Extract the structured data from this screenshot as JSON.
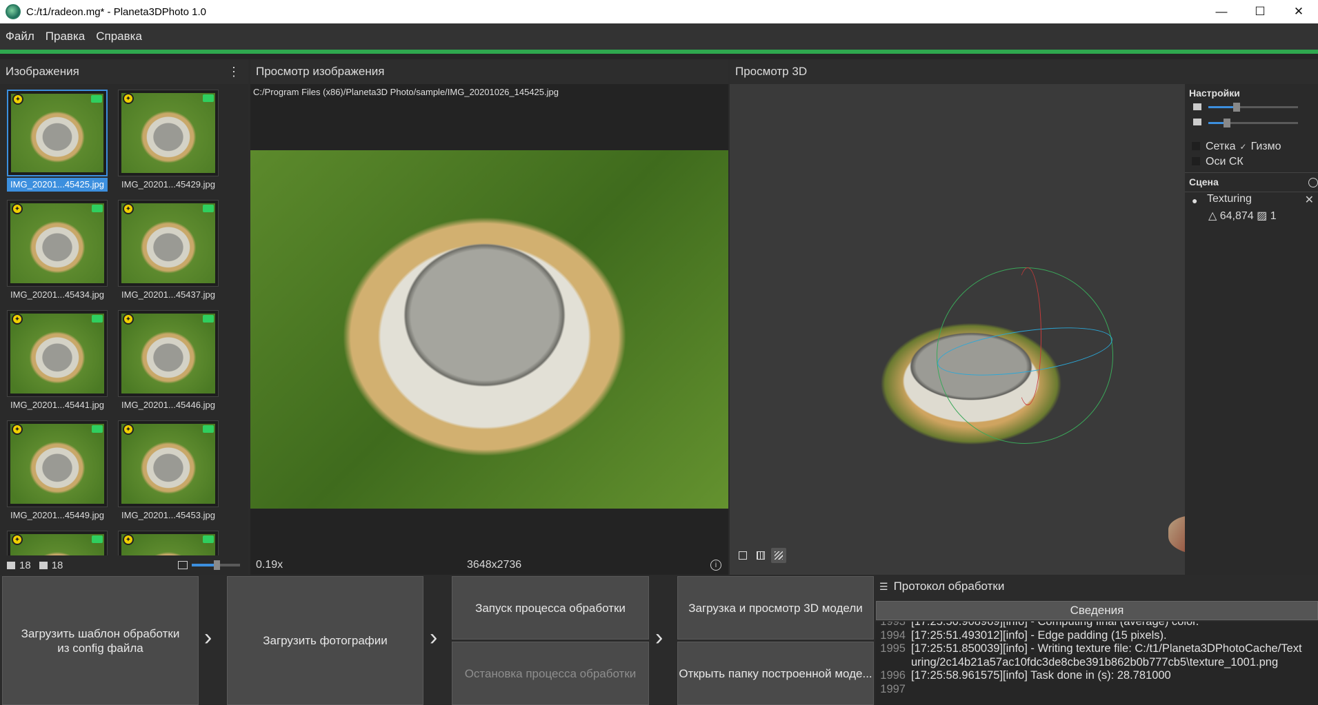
{
  "window": {
    "title": "C:/t1/radeon.mg* - Planeta3DPhoto 1.0",
    "minimize": "—",
    "maximize": "☐",
    "close": "✕"
  },
  "menu": [
    "Файл",
    "Правка",
    "Справка"
  ],
  "images_panel": {
    "title": "Изображения",
    "kebab": "⋮",
    "thumbnails": [
      {
        "name": "IMG_20201...45425.jpg",
        "selected": true
      },
      {
        "name": "IMG_20201...45429.jpg"
      },
      {
        "name": "IMG_20201...45434.jpg"
      },
      {
        "name": "IMG_20201...45437.jpg"
      },
      {
        "name": "IMG_20201...45441.jpg"
      },
      {
        "name": "IMG_20201...45446.jpg"
      },
      {
        "name": "IMG_20201...45449.jpg"
      },
      {
        "name": "IMG_20201...45453.jpg"
      }
    ],
    "image_count": "18",
    "camera_count": "18"
  },
  "viewer": {
    "title": "Просмотр изображения",
    "path": "C:/Program Files (x86)/Planeta3D Photo/sample/IMG_20201026_145425.jpg",
    "zoom": "0.19x",
    "resolution": "3648x2736",
    "info_icon": "i"
  },
  "view3d": {
    "title": "Просмотр 3D"
  },
  "settings": {
    "title": "Настройки",
    "grid_label": "Сетка",
    "gizmo_tick": "✓",
    "gizmo_label": "Гизмо",
    "axes_label": "Оси СК",
    "scene_title": "Сцена",
    "node_name": "Texturing",
    "node_close": "✕",
    "node_stats": "△ 64,874 ▨ 1"
  },
  "workflow": {
    "load_template": "Загрузить шаблон обработки из config файла",
    "load_photos": "Загрузить фотографии",
    "start_processing": "Запуск процесса обработки",
    "stop_processing": "Остановка процесса обработки",
    "load_view_model": "Загрузка и просмотр 3D модели",
    "open_model_folder": "Открыть папку построенной моде...",
    "chevron": "›"
  },
  "log": {
    "title": "Протокол обработки",
    "tab": "Сведения",
    "lines": [
      {
        "n": "1993",
        "t": "[17:25:50.908969][info]   - Computing final (average) color."
      },
      {
        "n": "1994",
        "t": "[17:25:51.493012][info]   - Edge padding (15 pixels)."
      },
      {
        "n": "1995",
        "t": "[17:25:51.850039][info]   - Writing texture file: C:/t1/Planeta3DPhotoCache/Text"
      },
      {
        "n": "",
        "t": "uring/2c14b21a57ac10fdc3de8cbe391b862b0b777cb5\\texture_1001.png"
      },
      {
        "n": "1996",
        "t": "[17:25:58.961575][info] Task done in (s): 28.781000"
      },
      {
        "n": "1997",
        "t": ""
      }
    ]
  },
  "colors": {
    "accent": "#3c8fde",
    "progress_green": "#2fa84f",
    "camera_badge": "#2fcf5f",
    "star_badge": "#f0d000"
  }
}
